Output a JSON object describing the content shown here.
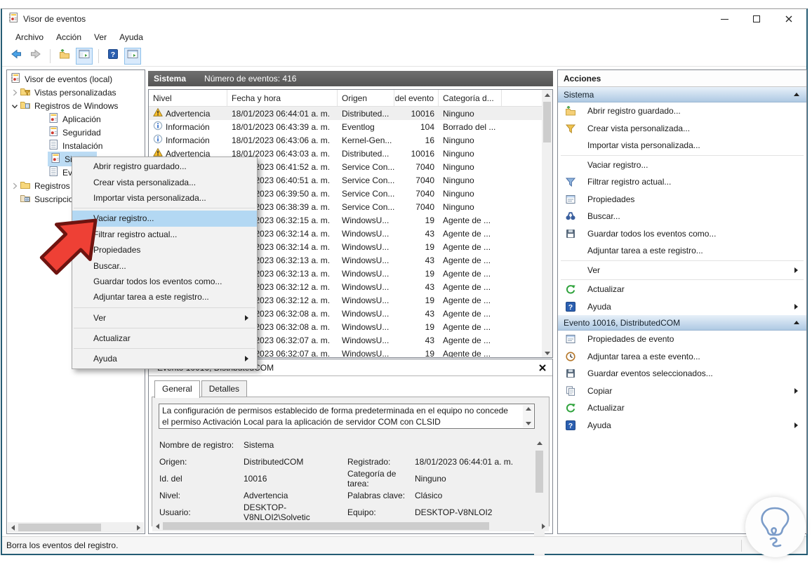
{
  "window": {
    "title": "Visor de eventos"
  },
  "menubar": [
    "Archivo",
    "Acción",
    "Ver",
    "Ayuda"
  ],
  "toolbar": {
    "buttons": [
      {
        "icon": "back-arrow",
        "name": "back"
      },
      {
        "icon": "forward-arrow",
        "name": "forward"
      },
      {
        "sep": true
      },
      {
        "icon": "open-folder",
        "name": "open-saved-log"
      },
      {
        "icon": "pane-toggle",
        "name": "toggle-console-tree",
        "boxed": true
      },
      {
        "sep": true
      },
      {
        "icon": "help",
        "name": "help"
      },
      {
        "icon": "pane-toggle",
        "name": "toggle-action-pane",
        "boxed": true
      }
    ]
  },
  "tree": {
    "items": [
      {
        "label": "Visor de eventos (local)",
        "icon": "logo",
        "indent": 0
      },
      {
        "label": "Vistas personalizadas",
        "icon": "folder-filter",
        "indent": 1,
        "expander": "collapsed"
      },
      {
        "label": "Registros de Windows",
        "icon": "folder-log",
        "indent": 1,
        "expander": "expanded"
      },
      {
        "label": "Aplicación",
        "icon": "log-red",
        "indent": 2
      },
      {
        "label": "Seguridad",
        "icon": "log-red",
        "indent": 2
      },
      {
        "label": "Instalación",
        "icon": "log",
        "indent": 2
      },
      {
        "label": "Sistema",
        "icon": "log-red",
        "indent": 2,
        "selected": true
      },
      {
        "label": "Eventos reenviados",
        "icon": "log",
        "indent": 2
      },
      {
        "label": "Registros de aplicaciones y servicios",
        "icon": "folder",
        "indent": 1,
        "expander": "collapsed"
      },
      {
        "label": "Suscripciones",
        "icon": "subscriptions",
        "indent": 1
      }
    ]
  },
  "events_pane": {
    "header": {
      "title": "Sistema",
      "subtitle": "Número de eventos: 416"
    },
    "columns": [
      "Nivel",
      "Fecha y hora",
      "Origen",
      "Id. del evento",
      "Categoría d..."
    ],
    "rows": [
      {
        "icon": "warning",
        "level": "Advertencia",
        "date": "18/01/2023 06:44:01 a. m.",
        "origin": "Distributed...",
        "id": "10016",
        "category": "Ninguno",
        "selected": true
      },
      {
        "icon": "info",
        "level": "Información",
        "date": "18/01/2023 06:43:39 a. m.",
        "origin": "Eventlog",
        "id": "104",
        "category": "Borrado del ..."
      },
      {
        "icon": "info",
        "level": "Información",
        "date": "18/01/2023 06:43:06 a. m.",
        "origin": "Kernel-Gen...",
        "id": "16",
        "category": "Ninguno"
      },
      {
        "icon": "warning",
        "level": "Advertencia",
        "date": "18/01/2023 06:43:03 a. m.",
        "origin": "Distributed...",
        "id": "10016",
        "category": "Ninguno"
      },
      {
        "icon": "",
        "level": "",
        "date": "18/01/2023 06:41:52 a. m.",
        "origin": "Service Con...",
        "id": "7040",
        "category": "Ninguno"
      },
      {
        "icon": "",
        "level": "",
        "date": "18/01/2023 06:40:51 a. m.",
        "origin": "Service Con...",
        "id": "7040",
        "category": "Ninguno"
      },
      {
        "icon": "",
        "level": "",
        "date": "18/01/2023 06:39:50 a. m.",
        "origin": "Service Con...",
        "id": "7040",
        "category": "Ninguno"
      },
      {
        "icon": "",
        "level": "",
        "date": "18/01/2023 06:38:39 a. m.",
        "origin": "Service Con...",
        "id": "7040",
        "category": "Ninguno"
      },
      {
        "icon": "",
        "level": "",
        "date": "18/01/2023 06:32:15 a. m.",
        "origin": "WindowsU...",
        "id": "19",
        "category": "Agente de ..."
      },
      {
        "icon": "",
        "level": "",
        "date": "18/01/2023 06:32:14 a. m.",
        "origin": "WindowsU...",
        "id": "43",
        "category": "Agente de ..."
      },
      {
        "icon": "",
        "level": "",
        "date": "18/01/2023 06:32:14 a. m.",
        "origin": "WindowsU...",
        "id": "19",
        "category": "Agente de ..."
      },
      {
        "icon": "",
        "level": "",
        "date": "18/01/2023 06:32:13 a. m.",
        "origin": "WindowsU...",
        "id": "43",
        "category": "Agente de ..."
      },
      {
        "icon": "",
        "level": "",
        "date": "18/01/2023 06:32:13 a. m.",
        "origin": "WindowsU...",
        "id": "19",
        "category": "Agente de ..."
      },
      {
        "icon": "",
        "level": "",
        "date": "18/01/2023 06:32:12 a. m.",
        "origin": "WindowsU...",
        "id": "43",
        "category": "Agente de ..."
      },
      {
        "icon": "",
        "level": "",
        "date": "18/01/2023 06:32:12 a. m.",
        "origin": "WindowsU...",
        "id": "19",
        "category": "Agente de ..."
      },
      {
        "icon": "",
        "level": "",
        "date": "18/01/2023 06:32:08 a. m.",
        "origin": "WindowsU...",
        "id": "43",
        "category": "Agente de ..."
      },
      {
        "icon": "",
        "level": "",
        "date": "18/01/2023 06:32:08 a. m.",
        "origin": "WindowsU...",
        "id": "19",
        "category": "Agente de ..."
      },
      {
        "icon": "",
        "level": "",
        "date": "18/01/2023 06:32:07 a. m.",
        "origin": "WindowsU...",
        "id": "43",
        "category": "Agente de ..."
      },
      {
        "icon": "",
        "level": "",
        "date": "18/01/2023 06:32:07 a. m.",
        "origin": "WindowsU...",
        "id": "19",
        "category": "Agente de ..."
      }
    ]
  },
  "context_menu": {
    "items": [
      {
        "label": "Abrir registro guardado..."
      },
      {
        "label": "Crear vista personalizada..."
      },
      {
        "label": "Importar vista personalizada..."
      },
      {
        "separator": true
      },
      {
        "label": "Vaciar registro...",
        "highlighted": true
      },
      {
        "label": "Filtrar registro actual..."
      },
      {
        "label": "Propiedades"
      },
      {
        "label": "Buscar..."
      },
      {
        "label": "Guardar todos los eventos como..."
      },
      {
        "label": "Adjuntar tarea a este registro..."
      },
      {
        "separator": true
      },
      {
        "label": "Ver",
        "submenu": true
      },
      {
        "separator": true
      },
      {
        "label": "Actualizar"
      },
      {
        "separator": true
      },
      {
        "label": "Ayuda",
        "submenu": true
      }
    ]
  },
  "detail_pane": {
    "title": "Evento 10016, DistributedCOM",
    "tabs": [
      "General",
      "Detalles"
    ],
    "active_tab": "General",
    "description_lines": [
      "La configuración de permisos establecido de forma predeterminada en el equipo no concede",
      "el permiso Activación Local para la aplicación de servidor COM con CLSID"
    ],
    "fields": [
      {
        "l1": "Nombre de registro:",
        "v1": "Sistema",
        "l2": "",
        "v2": ""
      },
      {
        "l1": "Origen:",
        "v1": "DistributedCOM",
        "l2": "Registrado:",
        "v2": "18/01/2023 06:44:01 a. m."
      },
      {
        "l1": "Id. del",
        "v1": "10016",
        "l2": "Categoría de tarea:",
        "v2": "Ninguno"
      },
      {
        "l1": "Nivel:",
        "v1": "Advertencia",
        "l2": "Palabras clave:",
        "v2": "Clásico"
      },
      {
        "l1": "Usuario:",
        "v1": "DESKTOP-V8NLOI2\\Solvetic",
        "l2": "Equipo:",
        "v2": "DESKTOP-V8NLOI2"
      }
    ]
  },
  "actions_pane": {
    "title": "Acciones",
    "sections": [
      {
        "title": "Sistema",
        "items": [
          {
            "icon": "open-folder",
            "label": "Abrir registro guardado..."
          },
          {
            "icon": "filter-yellow",
            "label": "Crear vista personalizada..."
          },
          {
            "icon": "",
            "label": "Importar vista personalizada..."
          },
          {
            "icon": "",
            "label": "Vaciar registro...",
            "sep_before": true
          },
          {
            "icon": "filter-blue",
            "label": "Filtrar registro actual..."
          },
          {
            "icon": "properties",
            "label": "Propiedades"
          },
          {
            "icon": "binoculars",
            "label": "Buscar..."
          },
          {
            "icon": "floppy",
            "label": "Guardar todos los eventos como..."
          },
          {
            "icon": "",
            "label": "Adjuntar tarea a este registro..."
          },
          {
            "icon": "",
            "label": "Ver",
            "submenu": true,
            "sep_before": true
          },
          {
            "icon": "refresh",
            "label": "Actualizar",
            "sep_before": true
          },
          {
            "icon": "help",
            "label": "Ayuda",
            "submenu": true
          }
        ]
      },
      {
        "title": "Evento 10016, DistributedCOM",
        "items": [
          {
            "icon": "properties",
            "label": "Propiedades de evento"
          },
          {
            "icon": "task-clock",
            "label": "Adjuntar tarea a este evento..."
          },
          {
            "icon": "floppy",
            "label": "Guardar eventos seleccionados..."
          },
          {
            "icon": "copy",
            "label": "Copiar",
            "submenu": true
          },
          {
            "icon": "refresh",
            "label": "Actualizar"
          },
          {
            "icon": "help",
            "label": "Ayuda",
            "submenu": true
          }
        ]
      }
    ]
  },
  "status_bar": {
    "text": "Borra los eventos del registro."
  },
  "colors": {
    "accent_selection": "#b3d8f3",
    "warning": "#fbc02d",
    "info": "#2566c9",
    "annotation_arrow": "#ee4035",
    "header_bar": "#5a5a5a"
  }
}
